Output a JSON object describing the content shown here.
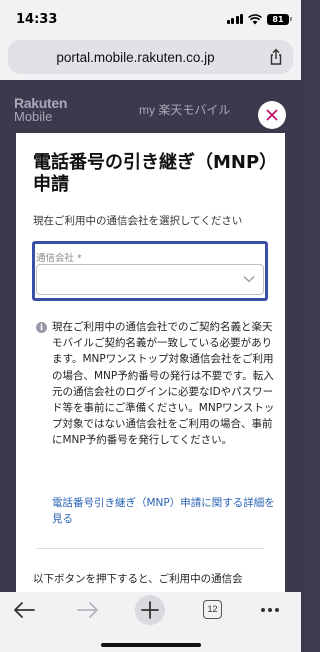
{
  "status_bar": {
    "time": "14:33",
    "battery": "81"
  },
  "browser": {
    "url": "portal.mobile.rakuten.co.jp",
    "tab_count": "12"
  },
  "background_page": {
    "logo_line1": "Rakuten",
    "logo_line2": "Mobile",
    "nav_text": "my 楽天モバイル"
  },
  "modal": {
    "title": "電話番号の引き継ぎ（MNP）申請",
    "instruction": "現在ご利用中の通信会社を選択してください",
    "select": {
      "label": "通信会社 *",
      "value": ""
    },
    "notice": "現在ご利用中の通信会社でのご契約名義と楽天モバイルご契約名義が一致している必要があります。MNPワンストップ対象通信会社をご利用の場合、MNP予約番号の発行は不要です。転入元の通信会社のログインに必要なIDやパスワード等を事前にご準備ください。MNPワンストップ対象ではない通信会社をご利用の場合、事前にMNP予約番号を発行してください。",
    "help_link": "電話番号引き継ぎ（MNP）申請に関する詳細を見る",
    "bottom_text": "以下ボタンを押下すると、ご利用中の通信会"
  },
  "colors": {
    "focus_ring": "#3a4ea8",
    "link": "#2b63b5",
    "close_icon": "#c7106e",
    "overlay": "#3b394c"
  },
  "icons": [
    "signal-icon",
    "wifi-icon",
    "battery-icon",
    "share-icon",
    "close-icon",
    "chevron-down-icon",
    "info-icon",
    "back-arrow-icon",
    "forward-arrow-icon",
    "plus-icon",
    "tabs-icon",
    "more-icon"
  ]
}
